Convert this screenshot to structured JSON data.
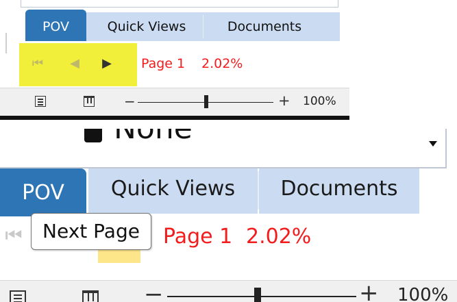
{
  "tabs": {
    "pov": "POV",
    "quick_views": "Quick Views",
    "documents": "Documents"
  },
  "navigation": {
    "first_icon": "skip-to-start-icon",
    "prev_icon": "previous-icon",
    "next_icon": "next-icon",
    "page_label": "Page 1",
    "percent_label": "2.02%"
  },
  "dropdown": {
    "selected_value": "None"
  },
  "tooltip": {
    "text": "Next Page"
  },
  "statusbar": {
    "single_page_icon": "single-page-icon",
    "book_view_icon": "book-view-icon",
    "zoom_minus": "−",
    "zoom_plus": "+",
    "zoom_level": "100%",
    "zoom_level_fraction": 0.5
  },
  "colors": {
    "pov_tab": "#2e75b6",
    "tab_strip": "#cbdcf2",
    "page_info_text": "#f21c1c",
    "nav_highlight_top": "#f2ef3b",
    "nav_highlight_bottom": "#fde58a"
  }
}
